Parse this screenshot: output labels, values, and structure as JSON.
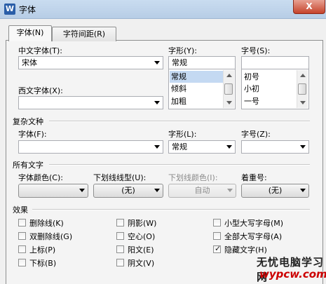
{
  "window": {
    "icon_label": "W",
    "title": "字体",
    "close_label": "X"
  },
  "tabs": [
    {
      "label": "字体(N)"
    },
    {
      "label": "字符间距(R)"
    }
  ],
  "font": {
    "chinese_label": "中文字体(T):",
    "chinese_value": "宋体",
    "western_label": "西文字体(X):",
    "western_value": "",
    "style_label": "字形(Y):",
    "style_value": "常规",
    "style_options": [
      "常规",
      "倾斜",
      "加粗"
    ],
    "size_label": "字号(S):",
    "size_value": "",
    "size_options": [
      "初号",
      "小初",
      "一号"
    ]
  },
  "complex": {
    "section_title": "复杂文种",
    "font_label": "字体(F):",
    "font_value": "",
    "style_label": "字形(L):",
    "style_value": "常规",
    "size_label": "字号(Z):",
    "size_value": ""
  },
  "all_text": {
    "section_title": "所有文字",
    "color_label": "字体颜色(C):",
    "color_value": "",
    "underline_label": "下划线线型(U):",
    "underline_value": "(无)",
    "underline_color_label": "下划线颜色(I):",
    "underline_color_value": "自动",
    "emphasis_label": "着重号:",
    "emphasis_value": "(无)"
  },
  "effects": {
    "section_title": "效果",
    "items": [
      {
        "label": "删除线(K)",
        "checked": false
      },
      {
        "label": "双删除线(G)",
        "checked": false
      },
      {
        "label": "上标(P)",
        "checked": false
      },
      {
        "label": "下标(B)",
        "checked": false
      },
      {
        "label": "阴影(W)",
        "checked": false
      },
      {
        "label": "空心(O)",
        "checked": false
      },
      {
        "label": "阳文(E)",
        "checked": false
      },
      {
        "label": "阴文(V)",
        "checked": false
      },
      {
        "label": "小型大写字母(M)",
        "checked": false
      },
      {
        "label": "全部大写字母(A)",
        "checked": false
      },
      {
        "label": "隐藏文字(H)",
        "checked": true
      }
    ],
    "check_glyph": "✓"
  },
  "watermark": {
    "line1": "无忧电脑学习网",
    "line2": "wypcw.com"
  }
}
